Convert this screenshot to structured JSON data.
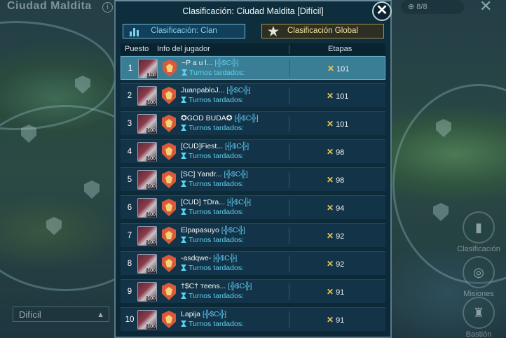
{
  "background": {
    "title": "Ciudad Maldita",
    "info_icon": "info-icon",
    "counter": "8/8",
    "difficulty_select": "Difícil",
    "side_buttons": [
      "Clasificación",
      "Misiones",
      "Bastión"
    ]
  },
  "modal": {
    "title": "Clasificación: Ciudad Maldita [Difícil]",
    "close_icon": "close-icon",
    "tabs": {
      "clan": "Clasificación: Clan",
      "global": "Clasificación Global"
    },
    "columns": {
      "rank": "Puesto",
      "player": "Info del jugador",
      "stages": "Etapas"
    },
    "turns_label": "Turnos tardados:",
    "rows": [
      {
        "rank": "1",
        "name": "~P a u l...",
        "tag": "[╬$C╬]",
        "level": "100",
        "stages": "101"
      },
      {
        "rank": "2",
        "name": "JuanpabloJ...",
        "tag": "[╬$C╬]",
        "level": "100",
        "stages": "101"
      },
      {
        "rank": "3",
        "name": "✪GOD BUDA✪",
        "tag": "[╬$C╬]",
        "level": "100",
        "stages": "101"
      },
      {
        "rank": "4",
        "name": "[CUD]Fiest...",
        "tag": "[╬$C╬]",
        "level": "100",
        "stages": "98"
      },
      {
        "rank": "5",
        "name": "[SC] Yandr...",
        "tag": "[╬$C╬]",
        "level": "100",
        "stages": "98"
      },
      {
        "rank": "6",
        "name": "[CUD] †Dra...",
        "tag": "[╬$C╬]",
        "level": "100",
        "stages": "94"
      },
      {
        "rank": "7",
        "name": "Elpapasuyo",
        "tag": "[╬$C╬]",
        "level": "100",
        "stages": "92"
      },
      {
        "rank": "8",
        "name": "-asdqwe-",
        "tag": "[╬$C╬]",
        "level": "100",
        "stages": "92"
      },
      {
        "rank": "9",
        "name": "†$C† тeens...",
        "tag": "[╬$C╬]",
        "level": "100",
        "stages": "91"
      },
      {
        "rank": "10",
        "name": "Lapija",
        "tag": "[╬$C╬]",
        "level": "100",
        "stages": "91"
      }
    ],
    "selected_row": 0,
    "colors": {
      "accent": "#5fd0f0",
      "gold": "#f2c94c",
      "selected_row": "#3a7e96"
    }
  }
}
